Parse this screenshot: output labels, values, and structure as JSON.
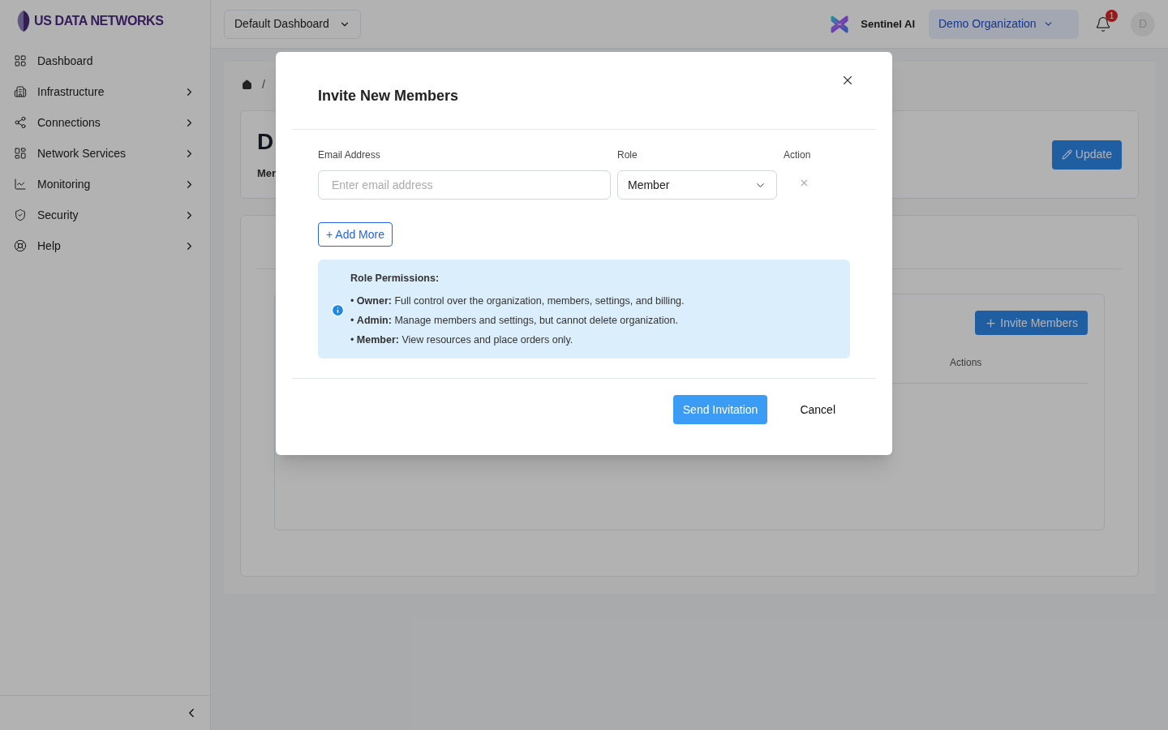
{
  "brand": {
    "name": "US DATA NETWORKS"
  },
  "sidebar": {
    "items": [
      {
        "label": "Dashboard",
        "expandable": false
      },
      {
        "label": "Infrastructure",
        "expandable": true
      },
      {
        "label": "Connections",
        "expandable": true
      },
      {
        "label": "Network Services",
        "expandable": true
      },
      {
        "label": "Monitoring",
        "expandable": true
      },
      {
        "label": "Security",
        "expandable": true
      },
      {
        "label": "Help",
        "expandable": true
      }
    ]
  },
  "topbar": {
    "dashboard_select": "Default Dashboard",
    "assistant": "Sentinel AI",
    "organization": "Demo Organization",
    "notification_count": "1",
    "avatar": "D"
  },
  "page": {
    "breadcrumb_separator": "/",
    "title": "D",
    "subtitle": "Mer",
    "update_button": "Update",
    "invite_button": "Invite Members",
    "table_columns": [
      "Actions"
    ]
  },
  "modal": {
    "title": "Invite New Members",
    "columns": [
      "Email Address",
      "Role",
      "Action"
    ],
    "rows": [
      {
        "email_placeholder": "Enter email address",
        "role": "Member"
      }
    ],
    "add_more": "+ Add More",
    "info": {
      "title": "Role Permissions:",
      "items": [
        "• **Owner:** Full control over the organization, members, settings, and billing.",
        "• **Admin:** Manage members and settings, but cannot delete organization.",
        "• **Member:** View resources and place orders only."
      ]
    },
    "buttons": [
      {
        "label": "Send Invitation",
        "kind": "primary"
      },
      {
        "label": "Cancel",
        "kind": "secondary"
      }
    ]
  }
}
